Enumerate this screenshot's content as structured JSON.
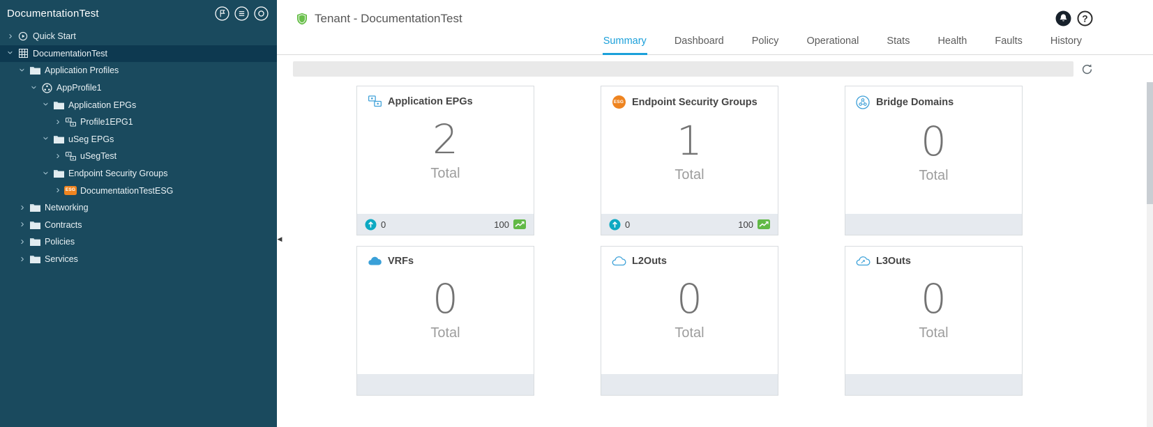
{
  "colors": {
    "sidebar_bg": "#1a4a5e",
    "sidebar_selected_bg": "#0d3950",
    "accent_blue": "#1ba0da",
    "esg_orange": "#ee8420",
    "health_teal": "#0da9c2",
    "score_green": "#61b946",
    "shield_green": "#69bf4b"
  },
  "badges": {
    "esg": "ESG"
  },
  "sidebar": {
    "title": "DocumentationTest",
    "header_icons": [
      "flag-icon",
      "list-icon",
      "target-icon"
    ],
    "tree": [
      {
        "label": "Quick Start",
        "icon": "quick-start-icon",
        "level": 0,
        "expanded": false,
        "selected": false
      },
      {
        "label": "DocumentationTest",
        "icon": "tenant-icon",
        "level": 0,
        "expanded": true,
        "selected": true
      },
      {
        "label": "Application Profiles",
        "icon": "folder-icon",
        "level": 1,
        "expanded": true,
        "selected": false
      },
      {
        "label": "AppProfile1",
        "icon": "app-profile-icon",
        "level": 2,
        "expanded": true,
        "selected": false
      },
      {
        "label": "Application EPGs",
        "icon": "folder-icon",
        "level": 3,
        "expanded": true,
        "selected": false
      },
      {
        "label": "Profile1EPG1",
        "icon": "epg-icon",
        "level": 4,
        "expanded": false,
        "selected": false
      },
      {
        "label": "uSeg EPGs",
        "icon": "folder-icon",
        "level": 3,
        "expanded": true,
        "selected": false
      },
      {
        "label": "uSegTest",
        "icon": "epg-icon",
        "level": 4,
        "expanded": false,
        "selected": false
      },
      {
        "label": "Endpoint Security Groups",
        "icon": "folder-icon",
        "level": 3,
        "expanded": true,
        "selected": false
      },
      {
        "label": "DocumentationTestESG",
        "icon": "esg-icon",
        "level": 4,
        "expanded": false,
        "selected": false
      },
      {
        "label": "Networking",
        "icon": "folder-icon",
        "level": 1,
        "expanded": false,
        "selected": false
      },
      {
        "label": "Contracts",
        "icon": "folder-icon",
        "level": 1,
        "expanded": false,
        "selected": false
      },
      {
        "label": "Policies",
        "icon": "folder-icon",
        "level": 1,
        "expanded": false,
        "selected": false
      },
      {
        "label": "Services",
        "icon": "folder-icon",
        "level": 1,
        "expanded": false,
        "selected": false
      }
    ]
  },
  "header": {
    "title": "Tenant - DocumentationTest",
    "icons": [
      "notifications-icon",
      "help-icon"
    ]
  },
  "tabs": [
    {
      "label": "Summary",
      "active": true
    },
    {
      "label": "Dashboard",
      "active": false
    },
    {
      "label": "Policy",
      "active": false
    },
    {
      "label": "Operational",
      "active": false
    },
    {
      "label": "Stats",
      "active": false
    },
    {
      "label": "Health",
      "active": false
    },
    {
      "label": "Faults",
      "active": false
    },
    {
      "label": "History",
      "active": false
    }
  ],
  "cards": [
    {
      "title": "Application EPGs",
      "icon": "epg-card-icon",
      "value": "2",
      "total_label": "Total",
      "footer": {
        "health": "0",
        "score": "100"
      }
    },
    {
      "title": "Endpoint Security Groups",
      "icon": "esg-card-icon",
      "value": "1",
      "total_label": "Total",
      "footer": {
        "health": "0",
        "score": "100"
      }
    },
    {
      "title": "Bridge Domains",
      "icon": "bridge-domain-icon",
      "value": "0",
      "total_label": "Total",
      "footer": null
    },
    {
      "title": "VRFs",
      "icon": "vrf-icon",
      "value": "0",
      "total_label": "Total",
      "footer": null
    },
    {
      "title": "L2Outs",
      "icon": "l2out-icon",
      "value": "0",
      "total_label": "Total",
      "footer": null
    },
    {
      "title": "L3Outs",
      "icon": "l3out-icon",
      "value": "0",
      "total_label": "Total",
      "footer": null
    }
  ]
}
